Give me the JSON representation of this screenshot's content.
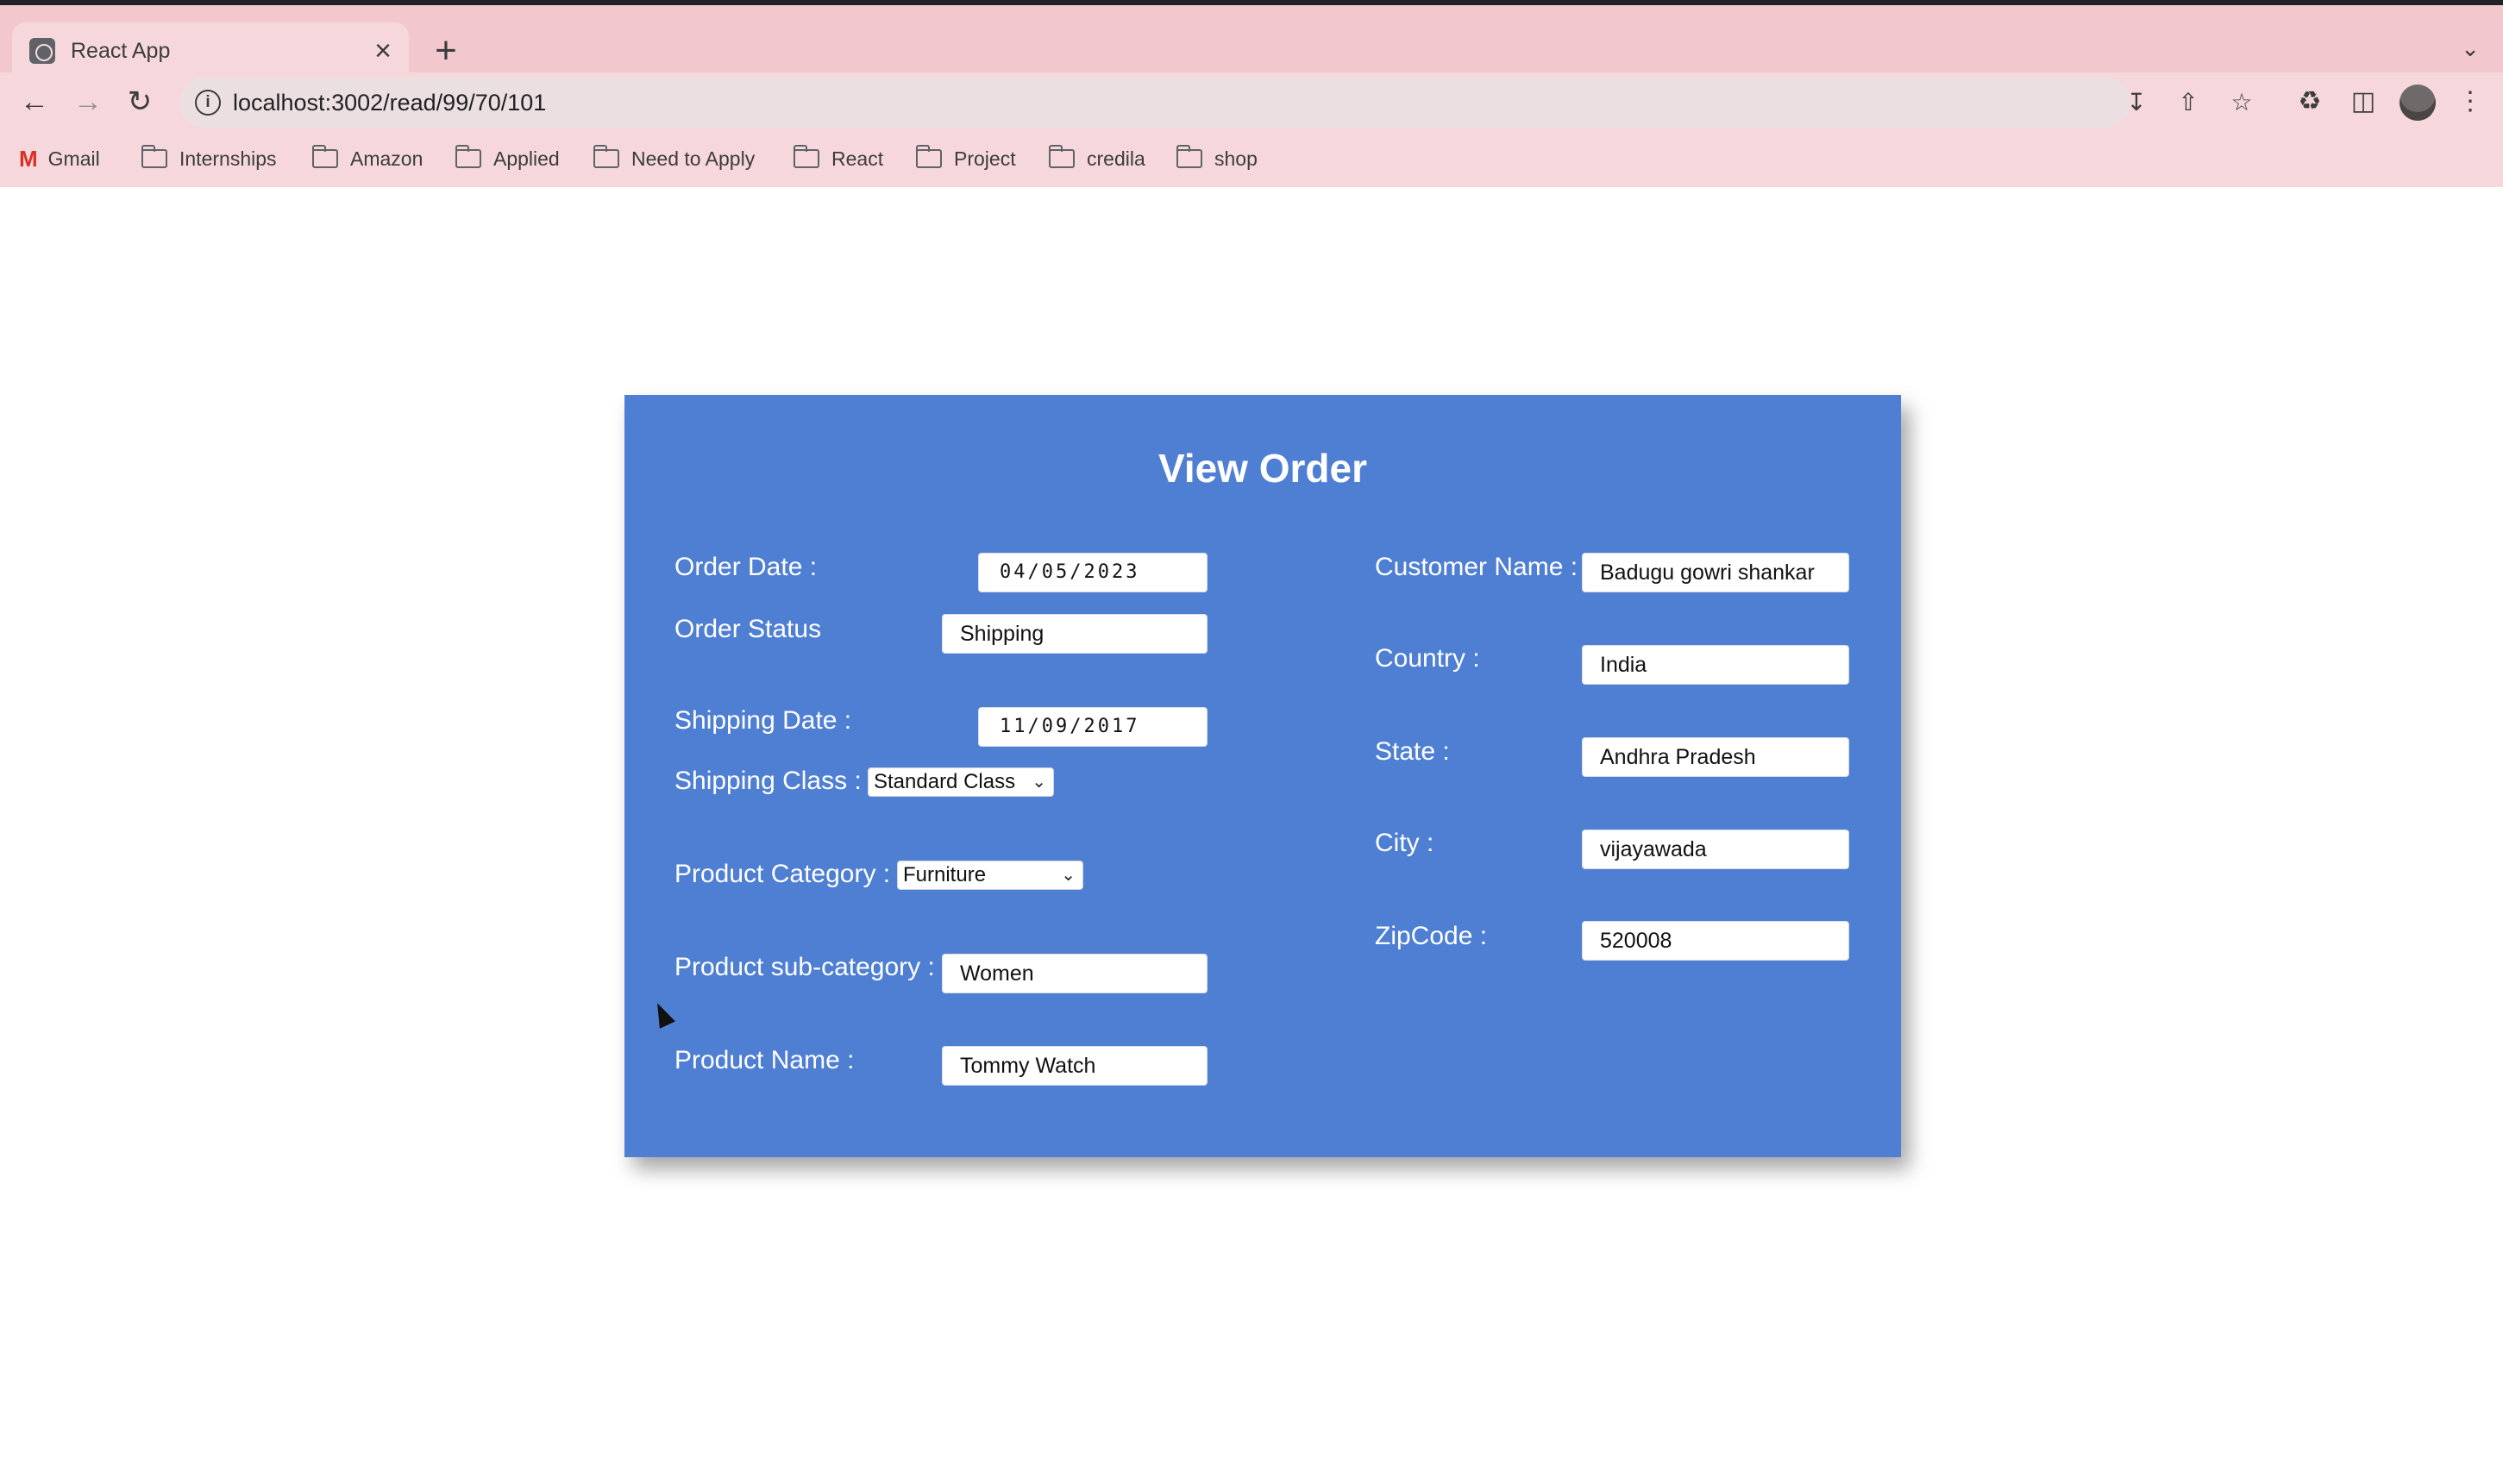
{
  "browser": {
    "tab_title": "React App",
    "tab_close": "×",
    "new_tab": "+",
    "tab_menu": "⌄",
    "url": "localhost:3002/read/99/70/101",
    "bookmarks": [
      "Gmail",
      "Internships",
      "Amazon",
      "Applied",
      "Need to Apply",
      "React",
      "Project",
      "credila",
      "shop"
    ]
  },
  "page": {
    "title": "View Order",
    "left": {
      "order_date": {
        "label": "Order Date :",
        "value": "04/05/2023"
      },
      "order_status": {
        "label": "Order Status",
        "value": "Shipping"
      },
      "shipping_date": {
        "label": "Shipping Date :",
        "value": "11/09/2017"
      },
      "shipping_class": {
        "label": "Shipping Class :",
        "value": "Standard Class"
      },
      "product_category": {
        "label": "Product Category :",
        "value": "Furniture"
      },
      "product_subcategory": {
        "label": "Product sub-category :",
        "value": "Women"
      },
      "product_name": {
        "label": "Product Name :",
        "value": "Tommy Watch"
      }
    },
    "right": {
      "customer_name": {
        "label": "Customer Name :",
        "value": "Badugu gowri shankar"
      },
      "country": {
        "label": "Country :",
        "value": "India"
      },
      "state": {
        "label": "State :",
        "value": "Andhra Pradesh"
      },
      "city": {
        "label": "City :",
        "value": "vijayawada"
      },
      "zipcode": {
        "label": "ZipCode :",
        "value": "520008"
      }
    }
  },
  "colors": {
    "card_bg": "#4f7fd3",
    "chrome_bg": "#f6d8dc",
    "tabstrip_bg": "#f2c7cd"
  }
}
